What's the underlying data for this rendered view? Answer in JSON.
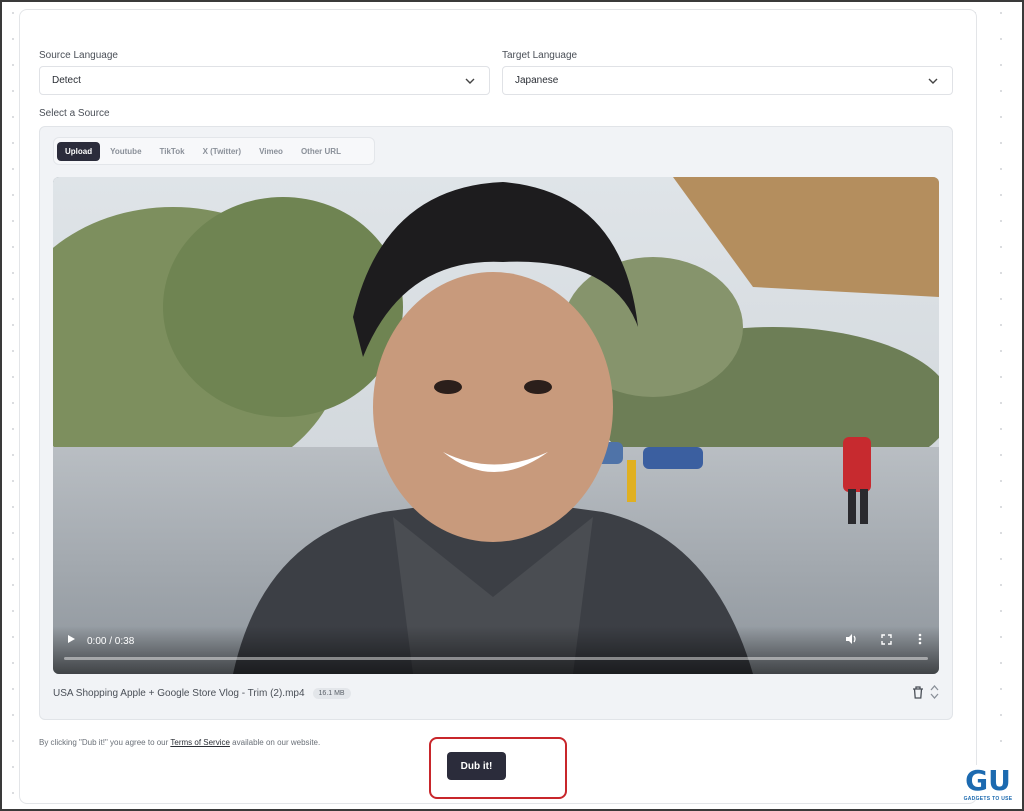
{
  "form": {
    "source_language_label": "Source Language",
    "source_language_value": "Detect",
    "target_language_label": "Target Language",
    "target_language_value": "Japanese",
    "select_source_label": "Select a Source"
  },
  "tabs": [
    {
      "label": "Upload",
      "active": true
    },
    {
      "label": "Youtube",
      "active": false
    },
    {
      "label": "TikTok",
      "active": false
    },
    {
      "label": "X (Twitter)",
      "active": false
    },
    {
      "label": "Vimeo",
      "active": false
    },
    {
      "label": "Other URL",
      "active": false
    }
  ],
  "video": {
    "time_display": "0:00 / 0:38",
    "progress_fraction": 0.0,
    "icons": [
      "play-icon",
      "volume-icon",
      "fullscreen-icon",
      "more-icon"
    ]
  },
  "file": {
    "name": "USA Shopping Apple + Google Store Vlog - Trim (2).mp4",
    "size": "16.1 MB"
  },
  "terms": {
    "prefix": "By clicking \"Dub it!\" you agree to our ",
    "link": "Terms of Service",
    "suffix": " available on our website."
  },
  "dub_button_label": "Dub it!",
  "colors": {
    "accent": "#2b2c3b",
    "highlight": "#c8262b",
    "watermark": "#1c6ab0"
  }
}
